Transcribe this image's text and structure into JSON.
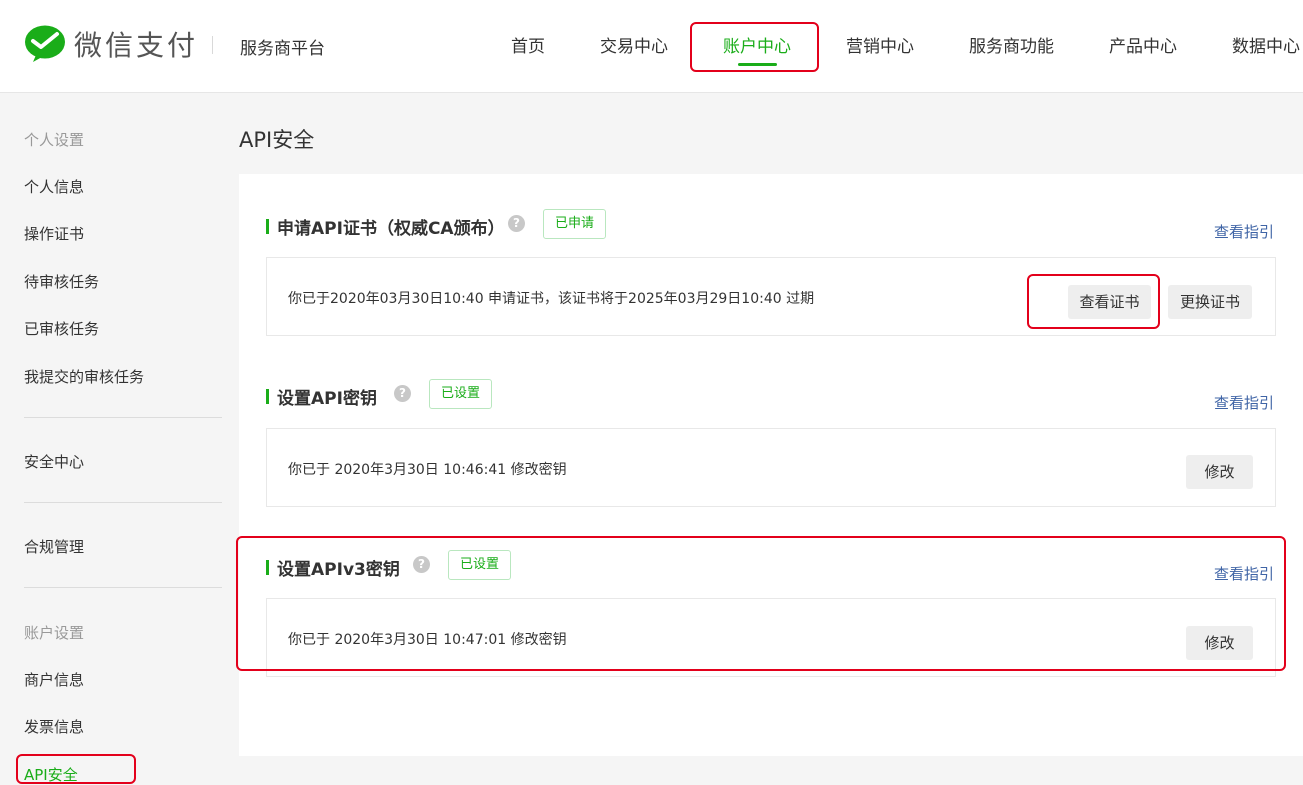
{
  "brand": {
    "logo_text": "微信支付",
    "platform": "服务商平台"
  },
  "nav": {
    "items": [
      {
        "label": "首页"
      },
      {
        "label": "交易中心"
      },
      {
        "label": "账户中心"
      },
      {
        "label": "营销中心"
      },
      {
        "label": "服务商功能"
      },
      {
        "label": "产品中心"
      },
      {
        "label": "数据中心"
      }
    ],
    "active": "账户中心"
  },
  "sidebar": {
    "group_personal": "个人设置",
    "personal_items": [
      {
        "label": "个人信息"
      },
      {
        "label": "操作证书"
      },
      {
        "label": "待审核任务"
      },
      {
        "label": "已审核任务"
      },
      {
        "label": "我提交的审核任务"
      }
    ],
    "security_center": "安全中心",
    "compliance": "合规管理",
    "group_account": "账户设置",
    "account_items": [
      {
        "label": "商户信息"
      },
      {
        "label": "发票信息"
      },
      {
        "label": "API安全"
      }
    ],
    "active": "API安全"
  },
  "main": {
    "title": "API安全",
    "sections": [
      {
        "title": "申请API证书（权威CA颁布）",
        "status": "已申请",
        "guide": "查看指引",
        "text": "你已于2020年03月30日10:40 申请证书，该证书将于2025年03月29日10:40 过期",
        "buttons": [
          "查看证书",
          "更换证书"
        ]
      },
      {
        "title": "设置API密钥",
        "status": "已设置",
        "guide": "查看指引",
        "text": "你已于 2020年3月30日 10:46:41 修改密钥",
        "buttons": [
          "修改"
        ]
      },
      {
        "title": "设置APIv3密钥",
        "status": "已设置",
        "guide": "查看指引",
        "text": "你已于 2020年3月30日 10:47:01 修改密钥",
        "buttons": [
          "修改"
        ]
      }
    ]
  },
  "colors": {
    "accent": "#1aad19",
    "highlight": "#e3001b",
    "link": "#3f64a6"
  },
  "icons": {
    "logo": "wechat-pay-logo-icon",
    "help": "question-circle-icon"
  }
}
